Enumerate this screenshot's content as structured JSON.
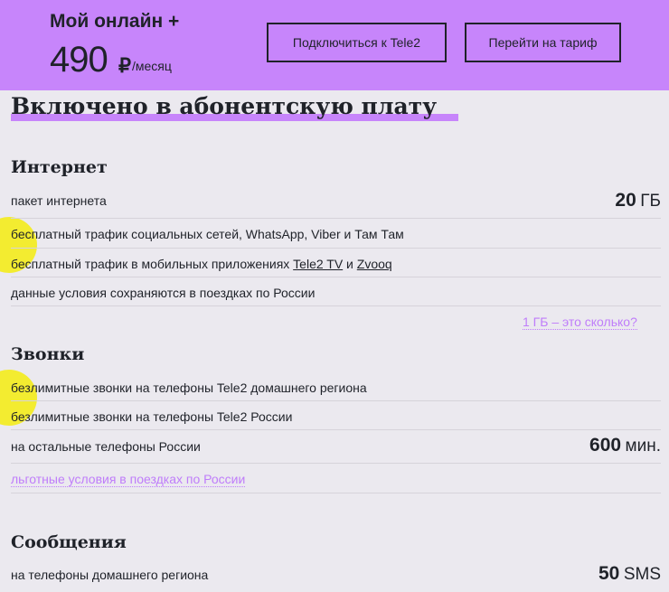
{
  "header": {
    "plan_name": "Мой онлайн +",
    "price": "490",
    "currency": "₽",
    "period": "/месяц",
    "connect_button": "Подключиться к Tele2",
    "switch_button": "Перейти на тариф"
  },
  "main": {
    "title": "Включено в абонентскую плату",
    "internet": {
      "title": "Интернет",
      "package_label": "пакет интернета",
      "package_value": "20",
      "package_unit": "ГБ",
      "social_free": "бесплатный трафик социальных сетей, WhatsApp, Viber и Там Там",
      "apps_free_prefix": "бесплатный трафик в мобильных приложениях ",
      "apps_link1": "Tele2 TV",
      "apps_and": " и ",
      "apps_link2": "Zvooq",
      "russia_trips": "данные условия сохраняются в поездках по России",
      "gb_help_link": "1 ГБ – это сколько?"
    },
    "calls": {
      "title": "Звонки",
      "unlimited_home": "безлимитные звонки  на телефоны Tele2 домашнего региона",
      "unlimited_russia": "безлимитные звонки  на телефоны Tele2 России",
      "other_label": "на остальные телефоны России",
      "other_value": "600",
      "other_unit": "мин.",
      "trips_link": "льготные условия в поездках по России"
    },
    "sms": {
      "title": "Сообщения",
      "home_label": "на телефоны домашнего региона",
      "home_value": "50",
      "home_unit": "SMS"
    }
  },
  "colors": {
    "accent_purple": "#c785fb",
    "highlight_yellow": "#f3ec1f",
    "text_dark": "#1f2229",
    "background": "#ebe9ef"
  }
}
